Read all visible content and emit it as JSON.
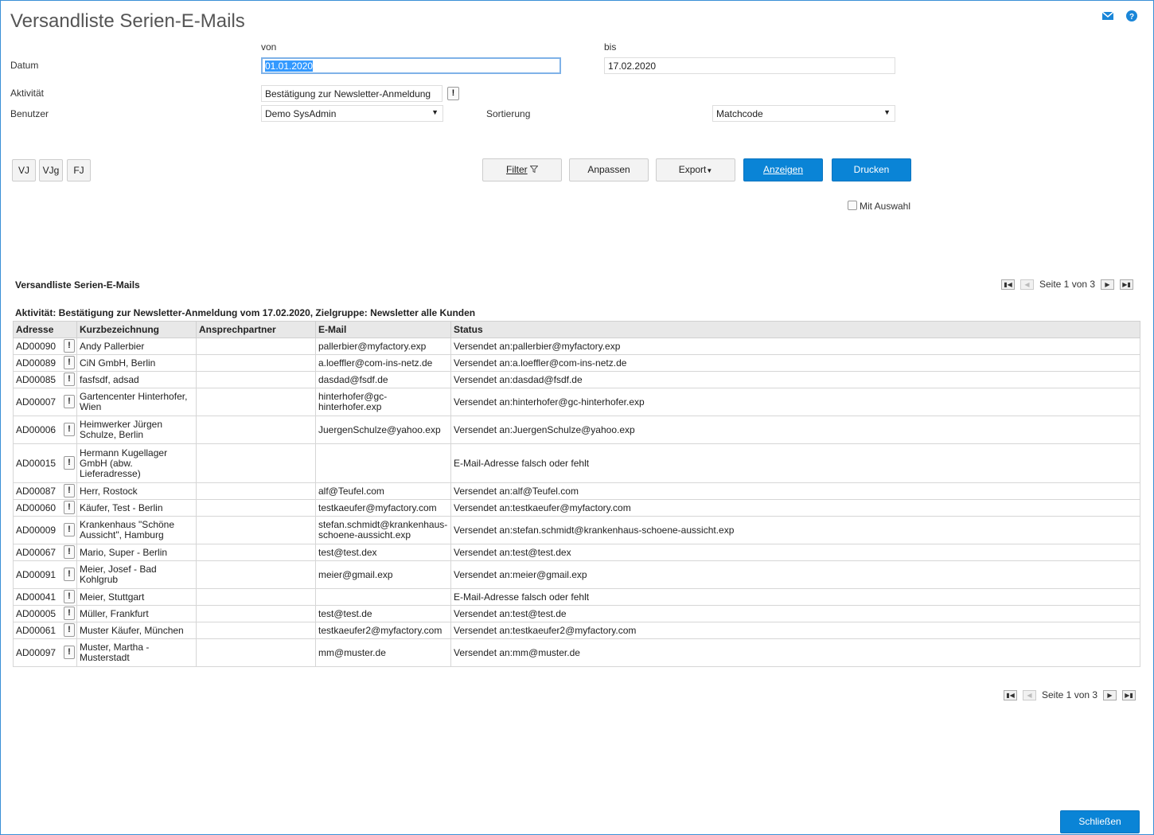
{
  "header": {
    "title": "Versandliste Serien-E-Mails",
    "mail_icon": "mail-icon",
    "help_icon": "help-icon"
  },
  "filters": {
    "von_label": "von",
    "bis_label": "bis",
    "datum_label": "Datum",
    "datum_von": "01.01.2020",
    "datum_bis": "17.02.2020",
    "aktivitaet_label": "Aktivität",
    "aktivitaet_value": "Bestätigung zur Newsletter-Anmeldung",
    "benutzer_label": "Benutzer",
    "benutzer_value": "Demo SysAdmin",
    "sortierung_label": "Sortierung",
    "sortierung_value": "Matchcode"
  },
  "period_buttons": [
    "VJ",
    "VJg",
    "FJ"
  ],
  "toolbar": {
    "filter": "Filter",
    "anpassen": "Anpassen",
    "export": "Export",
    "anzeigen": "Anzeigen",
    "drucken": "Drucken",
    "mit_auswahl": "Mit Auswahl"
  },
  "report": {
    "title": "Versandliste Serien-E-Mails",
    "subtitle": "Aktivität: Bestätigung zur Newsletter-Anmeldung vom 17.02.2020, Zielgruppe: Newsletter alle Kunden",
    "page_text": "Seite 1 von 3",
    "columns": [
      "Adresse",
      "Kurzbezeichnung",
      "Ansprechpartner",
      "E-Mail",
      "Status"
    ],
    "rows": [
      {
        "adresse": "AD00090",
        "kurz": "Andy Pallerbier",
        "ansprech": "",
        "email": "pallerbier@myfactory.exp",
        "status": "Versendet an:pallerbier@myfactory.exp"
      },
      {
        "adresse": "AD00089",
        "kurz": "CiN GmbH, Berlin",
        "ansprech": "",
        "email": "a.loeffler@com-ins-netz.de",
        "status": "Versendet an:a.loeffler@com-ins-netz.de"
      },
      {
        "adresse": "AD00085",
        "kurz": "fasfsdf, adsad",
        "ansprech": "",
        "email": "dasdad@fsdf.de",
        "status": "Versendet an:dasdad@fsdf.de"
      },
      {
        "adresse": "AD00007",
        "kurz": "Gartencenter Hinterhofer, Wien",
        "ansprech": "",
        "email": "hinterhofer@gc-hinterhofer.exp",
        "status": "Versendet an:hinterhofer@gc-hinterhofer.exp"
      },
      {
        "adresse": "AD00006",
        "kurz": "Heimwerker Jürgen Schulze, Berlin",
        "ansprech": "",
        "email": "JuergenSchulze@yahoo.exp",
        "status": "Versendet an:JuergenSchulze@yahoo.exp"
      },
      {
        "adresse": "AD00015",
        "kurz": "Hermann Kugellager GmbH (abw. Lieferadresse)",
        "ansprech": "",
        "email": "",
        "status": "E-Mail-Adresse falsch oder fehlt"
      },
      {
        "adresse": "AD00087",
        "kurz": "Herr, Rostock",
        "ansprech": "",
        "email": "alf@Teufel.com",
        "status": "Versendet an:alf@Teufel.com"
      },
      {
        "adresse": "AD00060",
        "kurz": "Käufer, Test - Berlin",
        "ansprech": "",
        "email": "testkaeufer@myfactory.com",
        "status": "Versendet an:testkaeufer@myfactory.com"
      },
      {
        "adresse": "AD00009",
        "kurz": "Krankenhaus \"Schöne Aussicht\", Hamburg",
        "ansprech": "",
        "email": "stefan.schmidt@krankenhaus-schoene-aussicht.exp",
        "status": "Versendet an:stefan.schmidt@krankenhaus-schoene-aussicht.exp"
      },
      {
        "adresse": "AD00067",
        "kurz": "Mario, Super - Berlin",
        "ansprech": "",
        "email": "test@test.dex",
        "status": "Versendet an:test@test.dex"
      },
      {
        "adresse": "AD00091",
        "kurz": "Meier, Josef - Bad Kohlgrub",
        "ansprech": "",
        "email": "meier@gmail.exp",
        "status": "Versendet an:meier@gmail.exp"
      },
      {
        "adresse": "AD00041",
        "kurz": "Meier, Stuttgart",
        "ansprech": "",
        "email": "",
        "status": "E-Mail-Adresse falsch oder fehlt"
      },
      {
        "adresse": "AD00005",
        "kurz": "Müller, Frankfurt",
        "ansprech": "",
        "email": "test@test.de",
        "status": "Versendet an:test@test.de"
      },
      {
        "adresse": "AD00061",
        "kurz": "Muster Käufer, München",
        "ansprech": "",
        "email": "testkaeufer2@myfactory.com",
        "status": "Versendet an:testkaeufer2@myfactory.com"
      },
      {
        "adresse": "AD00097",
        "kurz": "Muster, Martha - Musterstadt",
        "ansprech": "",
        "email": "mm@muster.de",
        "status": "Versendet an:mm@muster.de"
      }
    ]
  },
  "footer": {
    "close": "Schließen"
  },
  "colors": {
    "accent": "#0a84d6",
    "frame_border": "#3a8fd6"
  }
}
